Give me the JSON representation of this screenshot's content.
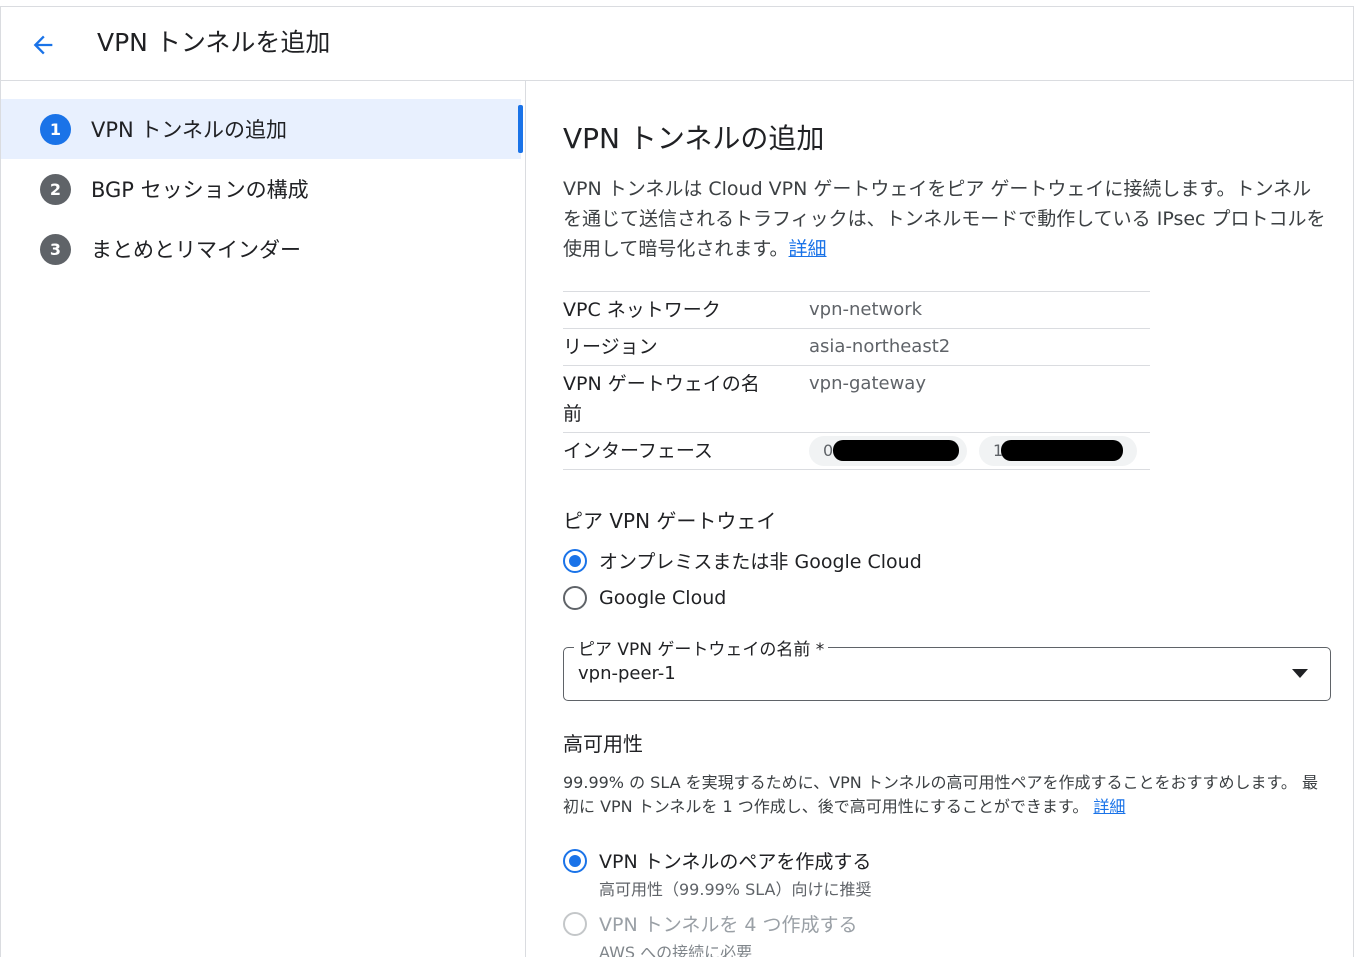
{
  "header": {
    "title": "VPN トンネルを追加"
  },
  "steps": [
    {
      "num": "1",
      "label": "VPN トンネルの追加"
    },
    {
      "num": "2",
      "label": "BGP セッションの構成"
    },
    {
      "num": "3",
      "label": "まとめとリマインダー"
    }
  ],
  "main": {
    "heading": "VPN トンネルの追加",
    "description": "VPN トンネルは Cloud VPN ゲートウェイをピア ゲートウェイに接続します。トンネルを通じて送信されるトラフィックは、トンネルモードで動作している IPsec プロトコルを使用して暗号化されます。",
    "learn_more": "詳細",
    "info": {
      "vpc_key": "VPC ネットワーク",
      "vpc_val": "vpn-network",
      "region_key": "リージョン",
      "region_val": "asia-northeast2",
      "gateway_key": "VPN ゲートウェイの名前",
      "gateway_val": "vpn-gateway",
      "interface_key": "インターフェース",
      "interface_0_prefix": "0",
      "interface_1_prefix": "1"
    },
    "peer_section_label": "ピア VPN ゲートウェイ",
    "peer_options": {
      "onprem": "オンプレミスまたは非 Google Cloud",
      "google": "Google Cloud"
    },
    "peer_select": {
      "label": "ピア VPN ゲートウェイの名前 *",
      "value": "vpn-peer-1"
    },
    "ha_section_label": "高可用性",
    "ha_description": "99.99% の SLA を実現するために、VPN トンネルの高可用性ペアを作成することをおすすめします。 最初に VPN トンネルを 1 つ作成し、後で高可用性にすることができます。",
    "ha_learn_more": "詳細",
    "ha_options": {
      "pair_label": "VPN トンネルのペアを作成する",
      "pair_sub": "高可用性（99.99% SLA）向けに推奨",
      "four_label": "VPN トンネルを 4 つ作成する",
      "four_sub": "AWS への接続に必要"
    }
  },
  "colors": {
    "accent": "#1a73e8",
    "active_step_bg": "#e8f0fe",
    "divider": "#dadce0"
  }
}
